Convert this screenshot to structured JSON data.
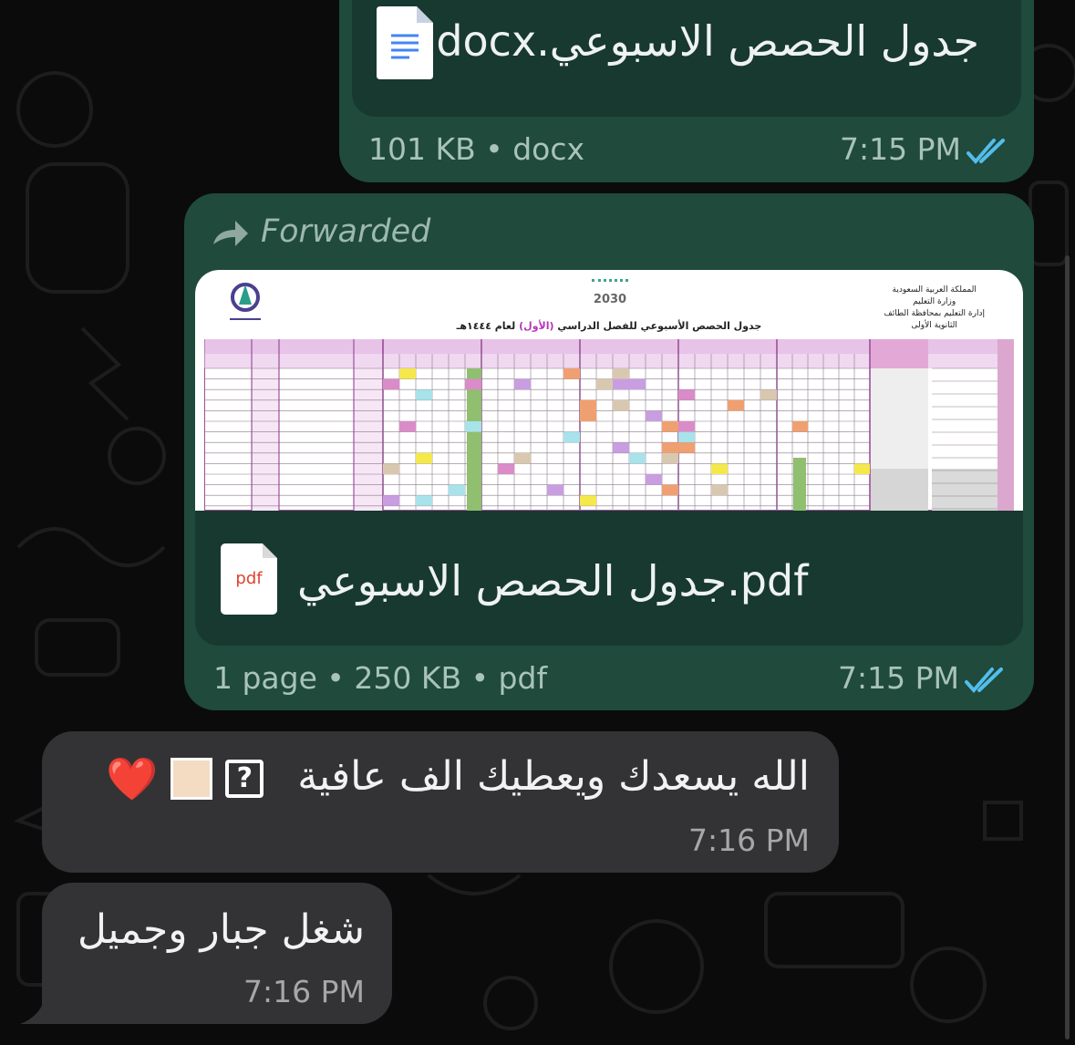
{
  "messages": [
    {
      "type": "document",
      "file_name": "جدول الحصص الاسبوعي.docx",
      "meta": "101 KB • docx",
      "time": "7:15 PM",
      "icon": "google-docs-icon",
      "status": "read-double-check"
    },
    {
      "type": "document",
      "forwarded_label": "Forwarded",
      "file_name": "جدول الحصص الاسبوعي.pdf",
      "meta": "1 page • 250 KB • pdf",
      "time": "7:15 PM",
      "icon_label": "pdf",
      "status": "read-double-check",
      "preview": {
        "header_right": [
          "المملكة العربية السعودية",
          "وزارة التعليم",
          "إدارة التعليم بمحافظة الطائف",
          "الثانوية الأولى"
        ],
        "title_prefix": "جدول الحصص الأسبوعي للفصل الدراسي",
        "title_term": "(الأول)",
        "title_suffix": "لعام ١٤٤٤هـ",
        "vision_label": "2030"
      }
    },
    {
      "type": "text",
      "text": "الله يسعدك ويعطيك الف عافية",
      "emoji": [
        "?",
        "",
        "❤️"
      ],
      "time": "7:16 PM"
    },
    {
      "type": "text",
      "text": "شغل جبار وجميل",
      "time": "7:16 PM"
    }
  ],
  "colors": {
    "outgoing_bubble": "#1f4a3c",
    "incoming_bubble": "#333335",
    "read_ticks": "#53bdeb",
    "background": "#0b0b0b"
  }
}
